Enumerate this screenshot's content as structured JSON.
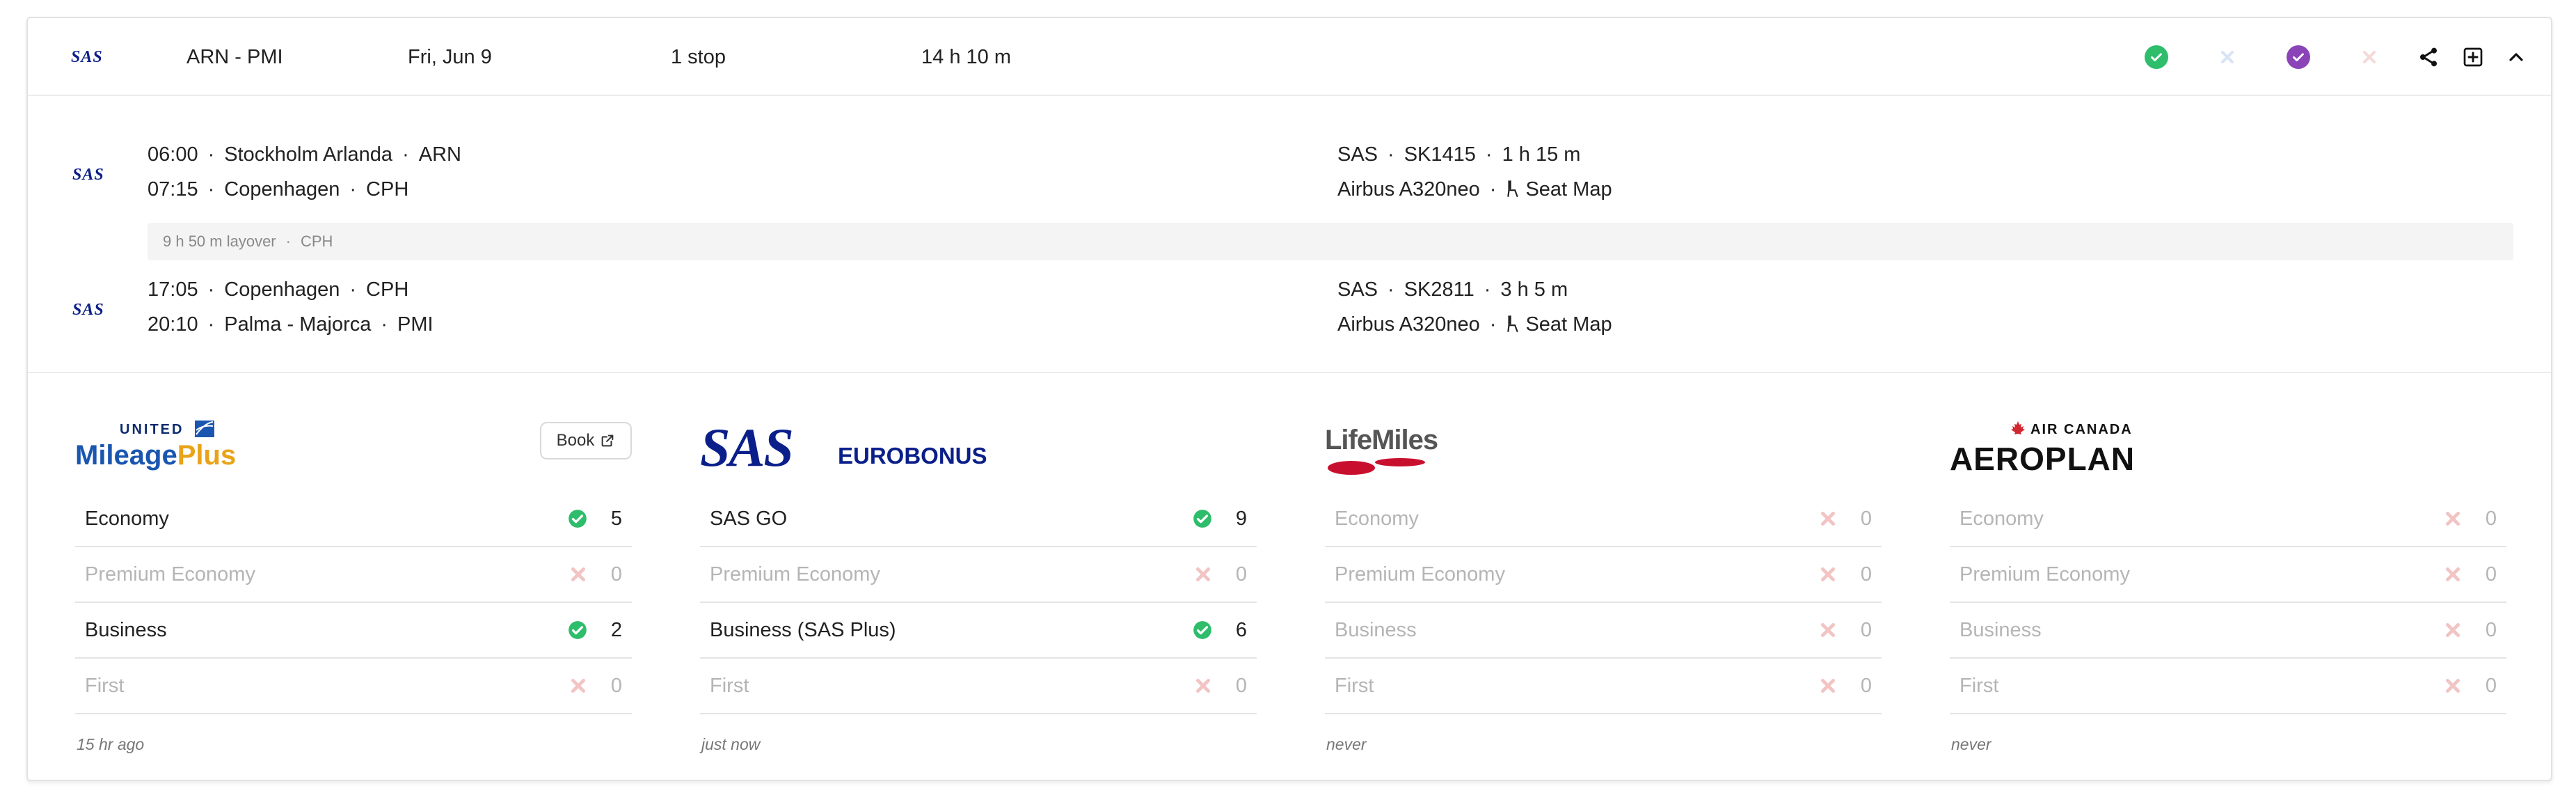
{
  "header": {
    "airline_logo": "SAS",
    "route": "ARN - PMI",
    "date": "Fri, Jun 9",
    "stops": "1 stop",
    "duration": "14 h 10 m",
    "status_icons": [
      {
        "name": "check-circle-icon",
        "color": "#2ebd6b"
      },
      {
        "name": "x-icon",
        "color": "#d7e3f5"
      },
      {
        "name": "check-circle-icon",
        "color": "#8a44b8"
      },
      {
        "name": "x-icon",
        "color": "#f5d9d9"
      }
    ],
    "actions": [
      "share-icon",
      "plus-square-icon",
      "chevron-up-icon"
    ]
  },
  "segments": [
    {
      "logo": "SAS",
      "dep_time": "06:00",
      "dep_airport": "Stockholm Arlanda",
      "dep_code": "ARN",
      "arr_time": "07:15",
      "arr_airport": "Copenhagen",
      "arr_code": "CPH",
      "carrier": "SAS",
      "flight": "SK1415",
      "flight_duration": "1 h 15 m",
      "aircraft": "Airbus A320neo",
      "seat_map": "Seat Map"
    },
    {
      "logo": "SAS",
      "dep_time": "17:05",
      "dep_airport": "Copenhagen",
      "dep_code": "CPH",
      "arr_time": "20:10",
      "arr_airport": "Palma - Majorca",
      "arr_code": "PMI",
      "carrier": "SAS",
      "flight": "SK2811",
      "flight_duration": "3 h 5 m",
      "aircraft": "Airbus A320neo",
      "seat_map": "Seat Map"
    }
  ],
  "layover": {
    "duration": "9 h 50 m layover",
    "airport": "CPH"
  },
  "programs": [
    {
      "logo_top": "UNITED",
      "logo_main_a": "Mileage",
      "logo_main_b": "Plus",
      "book_label": "Book",
      "rows": [
        {
          "label": "Economy",
          "available": true,
          "count": "5"
        },
        {
          "label": "Premium Economy",
          "available": false,
          "count": "0"
        },
        {
          "label": "Business",
          "available": true,
          "count": "2"
        },
        {
          "label": "First",
          "available": false,
          "count": "0"
        }
      ],
      "updated": "15 hr ago"
    },
    {
      "logo_main_a": "SAS",
      "logo_main_b": "EUROBONUS",
      "rows": [
        {
          "label": "SAS GO",
          "available": true,
          "count": "9"
        },
        {
          "label": "Premium Economy",
          "available": false,
          "count": "0"
        },
        {
          "label": "Business (SAS Plus)",
          "available": true,
          "count": "6"
        },
        {
          "label": "First",
          "available": false,
          "count": "0"
        }
      ],
      "updated": "just now"
    },
    {
      "logo_main_a": "LifeMiles",
      "rows": [
        {
          "label": "Economy",
          "available": false,
          "count": "0"
        },
        {
          "label": "Premium Economy",
          "available": false,
          "count": "0"
        },
        {
          "label": "Business",
          "available": false,
          "count": "0"
        },
        {
          "label": "First",
          "available": false,
          "count": "0"
        }
      ],
      "updated": "never"
    },
    {
      "logo_top": "AIR CANADA",
      "logo_main_a": "AEROPLAN",
      "rows": [
        {
          "label": "Economy",
          "available": false,
          "count": "0"
        },
        {
          "label": "Premium Economy",
          "available": false,
          "count": "0"
        },
        {
          "label": "Business",
          "available": false,
          "count": "0"
        },
        {
          "label": "First",
          "available": false,
          "count": "0"
        }
      ],
      "updated": "never"
    }
  ],
  "colors": {
    "available": "#2ebd6b",
    "unavailable": "#f2c4c4",
    "sas_blue": "#0b1f8a",
    "united_blue": "#1a56b0",
    "united_gold": "#e8a317",
    "lifemiles_red": "#c8102e",
    "aircanada_red": "#d22630"
  }
}
